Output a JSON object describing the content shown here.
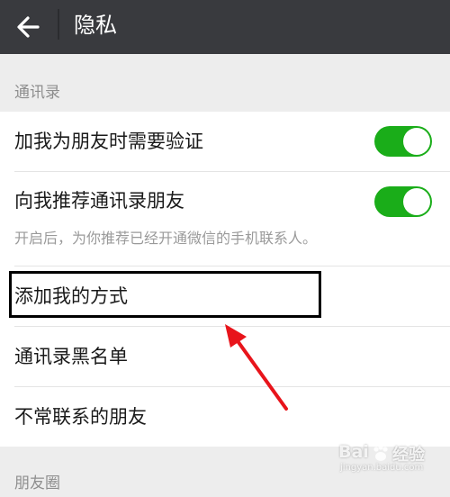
{
  "header": {
    "title": "隐私",
    "back_icon": "arrow-left-icon"
  },
  "sections": {
    "contacts_header": "通讯录",
    "moments_header": "朋友圈"
  },
  "rows": {
    "friend_verification": {
      "label": "加我为朋友时需要验证",
      "toggle_on": true
    },
    "recommend_contacts": {
      "label": "向我推荐通讯录朋友",
      "description": "开启后，为你推荐已经开通微信的手机联系人。",
      "toggle_on": true
    },
    "add_me_methods": {
      "label": "添加我的方式"
    },
    "contacts_blacklist": {
      "label": "通讯录黑名单"
    },
    "infrequent_friends": {
      "label": "不常联系的朋友"
    }
  },
  "colors": {
    "titlebar": "#393a3e",
    "toggle_on": "#1aad19",
    "annotation_arrow": "#e8141b",
    "background": "#ededed"
  },
  "watermark": {
    "brand": "Bai",
    "brand_suffix": "经验",
    "domain": "jingyan.baidu.com"
  }
}
